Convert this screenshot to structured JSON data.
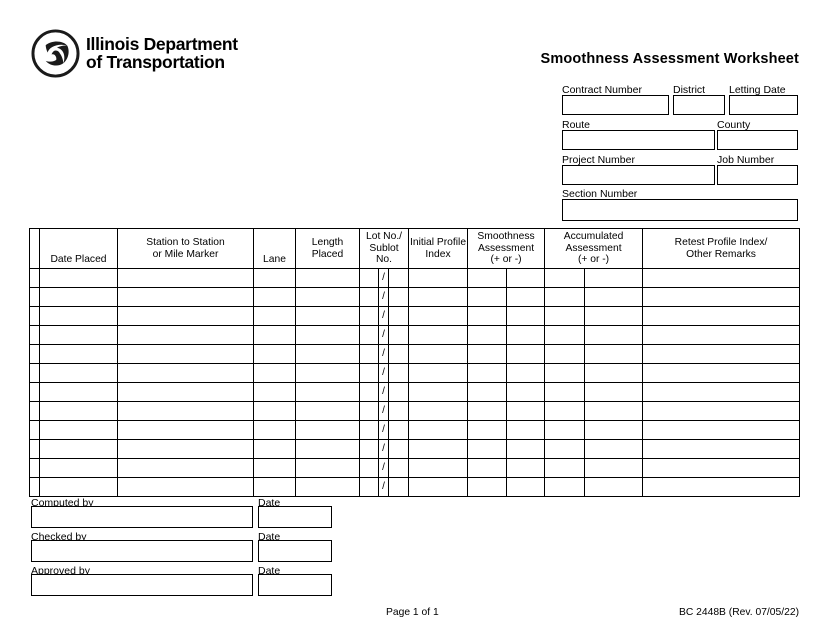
{
  "document": {
    "title": "Smoothness Assessment Worksheet",
    "agency_line_1": "Illinois Department",
    "agency_line_2": "of Transportation",
    "logo_icon": "idot-triskelion-logo"
  },
  "header_fields": [
    {
      "label": "Contract Number",
      "value": "",
      "name": "contract-number"
    },
    {
      "label": "District",
      "value": "",
      "name": "district"
    },
    {
      "label": "Letting Date",
      "value": "",
      "name": "letting-date"
    },
    {
      "label": "Route",
      "value": "",
      "name": "route"
    },
    {
      "label": "County",
      "value": "",
      "name": "county"
    },
    {
      "label": "Project Number",
      "value": "",
      "name": "project-number"
    },
    {
      "label": "Job Number",
      "value": "",
      "name": "job-number"
    },
    {
      "label": "Section Number",
      "value": "",
      "name": "section-number"
    }
  ],
  "table": {
    "columns": [
      {
        "label": "",
        "name": "row-marker"
      },
      {
        "label": "Date Placed",
        "name": "date-placed"
      },
      {
        "label": "Station to Station or Mile Marker",
        "name": "station-to-station"
      },
      {
        "label": "Lane",
        "name": "lane"
      },
      {
        "label": "Length Placed",
        "name": "length-placed"
      },
      {
        "label": "Lot No./ Sublot No.",
        "name": "lot-sublot-no"
      },
      {
        "label": "Initial Profile Index",
        "name": "initial-profile-index"
      },
      {
        "label": "Smoothness Assessment (+ or -)",
        "name": "smoothness-assessment"
      },
      {
        "label": "Accumulated Assessment (+ or -)",
        "name": "accumulated-assessment"
      },
      {
        "label": "Retest Profile Index/ Other Remarks",
        "name": "retest-profile-index"
      }
    ],
    "column_label_lines": {
      "date_placed": [
        "Date Placed"
      ],
      "station": [
        "Station to Station",
        "or Mile Marker"
      ],
      "lane": [
        "Lane"
      ],
      "length_placed": [
        "Length",
        "Placed"
      ],
      "lot_sublot": [
        "Lot No./",
        "Sublot",
        "No."
      ],
      "initial_profile": [
        "Initial Profile",
        "Index"
      ],
      "smoothness": [
        "Smoothness",
        "Assessment",
        "(+ or -)"
      ],
      "accumulated": [
        "Accumulated",
        "Assessment",
        "(+ or -)"
      ],
      "retest": [
        "Retest Profile Index/",
        "Other Remarks"
      ]
    },
    "slash_separator": "/",
    "row_count": 12,
    "rows": [
      {
        "date_placed": "",
        "station": "",
        "lane": "",
        "length_placed": "",
        "lot_no": "",
        "sublot_no": "",
        "initial_profile": "",
        "smoothness_a": "",
        "smoothness_b": "",
        "accumulated_a": "",
        "accumulated_b": "",
        "retest": ""
      },
      {
        "date_placed": "",
        "station": "",
        "lane": "",
        "length_placed": "",
        "lot_no": "",
        "sublot_no": "",
        "initial_profile": "",
        "smoothness_a": "",
        "smoothness_b": "",
        "accumulated_a": "",
        "accumulated_b": "",
        "retest": ""
      },
      {
        "date_placed": "",
        "station": "",
        "lane": "",
        "length_placed": "",
        "lot_no": "",
        "sublot_no": "",
        "initial_profile": "",
        "smoothness_a": "",
        "smoothness_b": "",
        "accumulated_a": "",
        "accumulated_b": "",
        "retest": ""
      },
      {
        "date_placed": "",
        "station": "",
        "lane": "",
        "length_placed": "",
        "lot_no": "",
        "sublot_no": "",
        "initial_profile": "",
        "smoothness_a": "",
        "smoothness_b": "",
        "accumulated_a": "",
        "accumulated_b": "",
        "retest": ""
      },
      {
        "date_placed": "",
        "station": "",
        "lane": "",
        "length_placed": "",
        "lot_no": "",
        "sublot_no": "",
        "initial_profile": "",
        "smoothness_a": "",
        "smoothness_b": "",
        "accumulated_a": "",
        "accumulated_b": "",
        "retest": ""
      },
      {
        "date_placed": "",
        "station": "",
        "lane": "",
        "length_placed": "",
        "lot_no": "",
        "sublot_no": "",
        "initial_profile": "",
        "smoothness_a": "",
        "smoothness_b": "",
        "accumulated_a": "",
        "accumulated_b": "",
        "retest": ""
      },
      {
        "date_placed": "",
        "station": "",
        "lane": "",
        "length_placed": "",
        "lot_no": "",
        "sublot_no": "",
        "initial_profile": "",
        "smoothness_a": "",
        "smoothness_b": "",
        "accumulated_a": "",
        "accumulated_b": "",
        "retest": ""
      },
      {
        "date_placed": "",
        "station": "",
        "lane": "",
        "length_placed": "",
        "lot_no": "",
        "sublot_no": "",
        "initial_profile": "",
        "smoothness_a": "",
        "smoothness_b": "",
        "accumulated_a": "",
        "accumulated_b": "",
        "retest": ""
      },
      {
        "date_placed": "",
        "station": "",
        "lane": "",
        "length_placed": "",
        "lot_no": "",
        "sublot_no": "",
        "initial_profile": "",
        "smoothness_a": "",
        "smoothness_b": "",
        "accumulated_a": "",
        "accumulated_b": "",
        "retest": ""
      },
      {
        "date_placed": "",
        "station": "",
        "lane": "",
        "length_placed": "",
        "lot_no": "",
        "sublot_no": "",
        "initial_profile": "",
        "smoothness_a": "",
        "smoothness_b": "",
        "accumulated_a": "",
        "accumulated_b": "",
        "retest": ""
      },
      {
        "date_placed": "",
        "station": "",
        "lane": "",
        "length_placed": "",
        "lot_no": "",
        "sublot_no": "",
        "initial_profile": "",
        "smoothness_a": "",
        "smoothness_b": "",
        "accumulated_a": "",
        "accumulated_b": "",
        "retest": ""
      },
      {
        "date_placed": "",
        "station": "",
        "lane": "",
        "length_placed": "",
        "lot_no": "",
        "sublot_no": "",
        "initial_profile": "",
        "smoothness_a": "",
        "smoothness_b": "",
        "accumulated_a": "",
        "accumulated_b": "",
        "retest": ""
      }
    ]
  },
  "signatures": [
    {
      "label": "Computed by",
      "value": "",
      "date_label": "Date",
      "date_value": "",
      "name": "computed-by"
    },
    {
      "label": "Checked by",
      "value": "",
      "date_label": "Date",
      "date_value": "",
      "name": "checked-by"
    },
    {
      "label": "Approved by",
      "value": "",
      "date_label": "Date",
      "date_value": "",
      "name": "approved-by"
    }
  ],
  "footer": {
    "page": "Page 1 of 1",
    "form_id": "BC 2448B (Rev. 07/05/22)"
  },
  "colors": {
    "ink": "#000000",
    "paper": "#ffffff"
  }
}
